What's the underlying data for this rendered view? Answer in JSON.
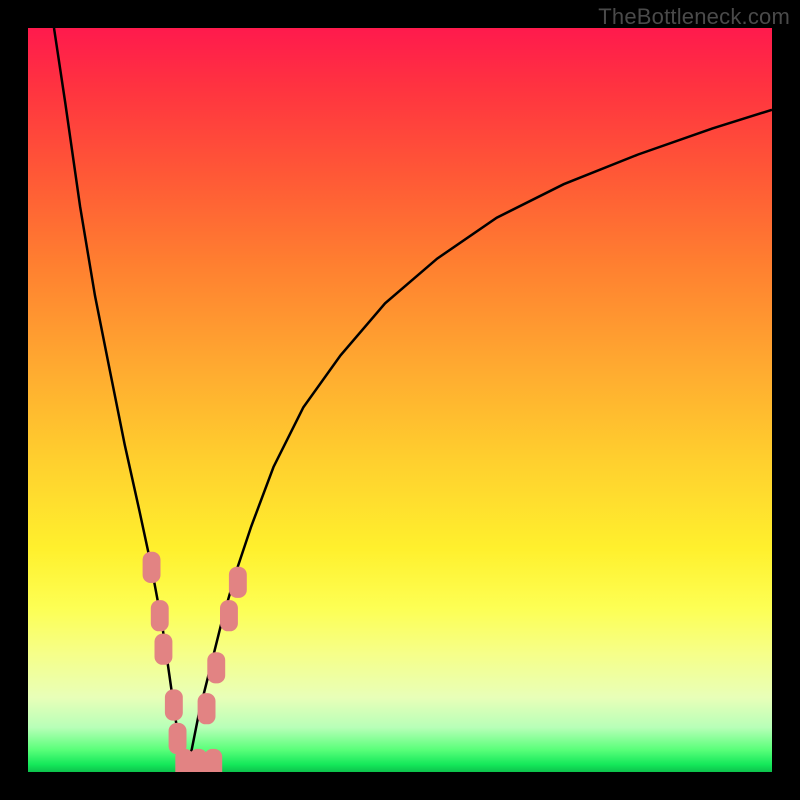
{
  "watermark": "TheBottleneck.com",
  "colors": {
    "frame": "#000000",
    "curve": "#000000",
    "marker": "#e28383",
    "gradient_top": "#ff1a4d",
    "gradient_bottom": "#0dc24c"
  },
  "chart_data": {
    "type": "line",
    "title": "",
    "xlabel": "",
    "ylabel": "",
    "xlim": [
      0,
      100
    ],
    "ylim": [
      0,
      100
    ],
    "note": "No visible tick labels or axis numerics; x/y coordinates are in percent of plot area (0,0 = bottom-left). Curve is the black V-shaped line; markers are the salmon rounded-rectangle points overlaid on the curve near the minimum.",
    "series": [
      {
        "name": "bottleneck-curve",
        "x": [
          3.5,
          5,
          7,
          9,
          11,
          13,
          15,
          16.5,
          18,
          19,
          20,
          21,
          22,
          23,
          24.5,
          26,
          28,
          30,
          33,
          37,
          42,
          48,
          55,
          63,
          72,
          82,
          92,
          100
        ],
        "y": [
          100,
          90,
          76,
          64,
          54,
          44,
          35,
          28,
          20,
          13,
          6,
          0.5,
          3,
          8,
          14,
          20,
          27,
          33,
          41,
          49,
          56,
          63,
          69,
          74.5,
          79,
          83,
          86.5,
          89
        ]
      }
    ],
    "markers": {
      "name": "highlighted-points",
      "shape": "rounded-rect",
      "approx_size_pct": [
        2.4,
        4.2
      ],
      "points": [
        {
          "x": 16.6,
          "y": 27.5
        },
        {
          "x": 17.7,
          "y": 21.0
        },
        {
          "x": 18.2,
          "y": 16.5
        },
        {
          "x": 19.6,
          "y": 9.0
        },
        {
          "x": 20.1,
          "y": 4.5
        },
        {
          "x": 21.0,
          "y": 1.0
        },
        {
          "x": 22.9,
          "y": 1.0
        },
        {
          "x": 24.9,
          "y": 1.0
        },
        {
          "x": 24.0,
          "y": 8.5
        },
        {
          "x": 25.3,
          "y": 14.0
        },
        {
          "x": 27.0,
          "y": 21.0
        },
        {
          "x": 28.2,
          "y": 25.5
        }
      ]
    }
  }
}
